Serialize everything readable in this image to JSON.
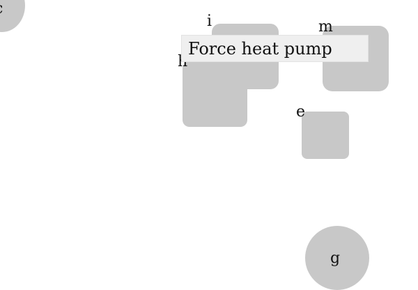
{
  "colors": {
    "background": "#ffffff",
    "node_fill": "#c8c8c8",
    "tooltip_fill": "#efefef",
    "text": "#111111"
  },
  "nodes": {
    "c": {
      "label": "c",
      "shape": "circle"
    },
    "i": {
      "label": "i",
      "shape": "rounded-square"
    },
    "h": {
      "label": "h",
      "shape": "rounded-square"
    },
    "m": {
      "label": "m",
      "shape": "rounded-square"
    },
    "e": {
      "label": "e",
      "shape": "rounded-square"
    },
    "g": {
      "label": "g",
      "shape": "circle"
    }
  },
  "tooltip": {
    "text": "Force heat pump"
  }
}
